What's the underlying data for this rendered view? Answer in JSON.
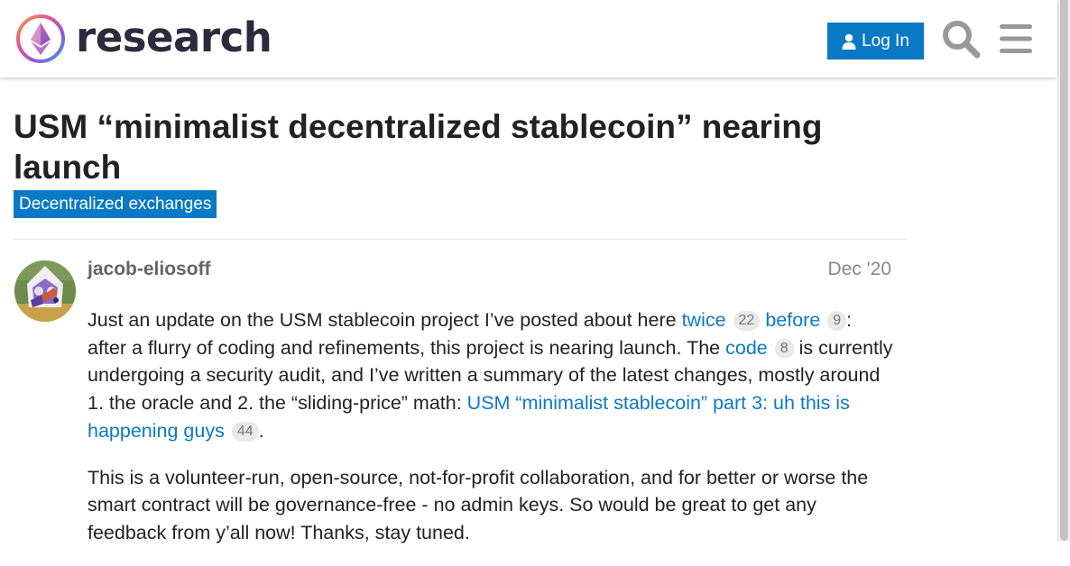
{
  "header": {
    "brand": "research",
    "login_label": "Log In",
    "icons": [
      "ethereum-logo-icon",
      "user-icon",
      "search-icon",
      "hamburger-menu-icon"
    ],
    "accent_color": "#0a79c5"
  },
  "topic": {
    "title": "USM “minimalist decentralized stablecoin” nearing launch",
    "category": "Decentralized exchanges"
  },
  "post": {
    "username": "jacob-eliosoff",
    "date": "Dec '20",
    "p1": {
      "t1": "Just an update on the USM stablecoin project I’ve posted about here ",
      "link1": "twice",
      "link1_clicks": "22",
      "link2": "before",
      "link2_clicks": "9",
      "t2": ": after a flurry of coding and refinements, this project is nearing launch. The ",
      "link3": "code",
      "link3_clicks": "8",
      "t3": " is currently undergoing a security audit, and I’ve written a summary of the latest changes, mostly around 1. the oracle and 2. the “sliding-price” math: ",
      "link4": "USM “minimalist stablecoin” part 3: uh this is happening guys",
      "link4_clicks": "44",
      "t4": "."
    },
    "p2": "This is a volunteer-run, open-source, not-for-profit collaboration, and for better or worse the smart contract will be governance-free - no admin keys. So would be great to get any feedback from y’all now! Thanks, stay tuned."
  }
}
